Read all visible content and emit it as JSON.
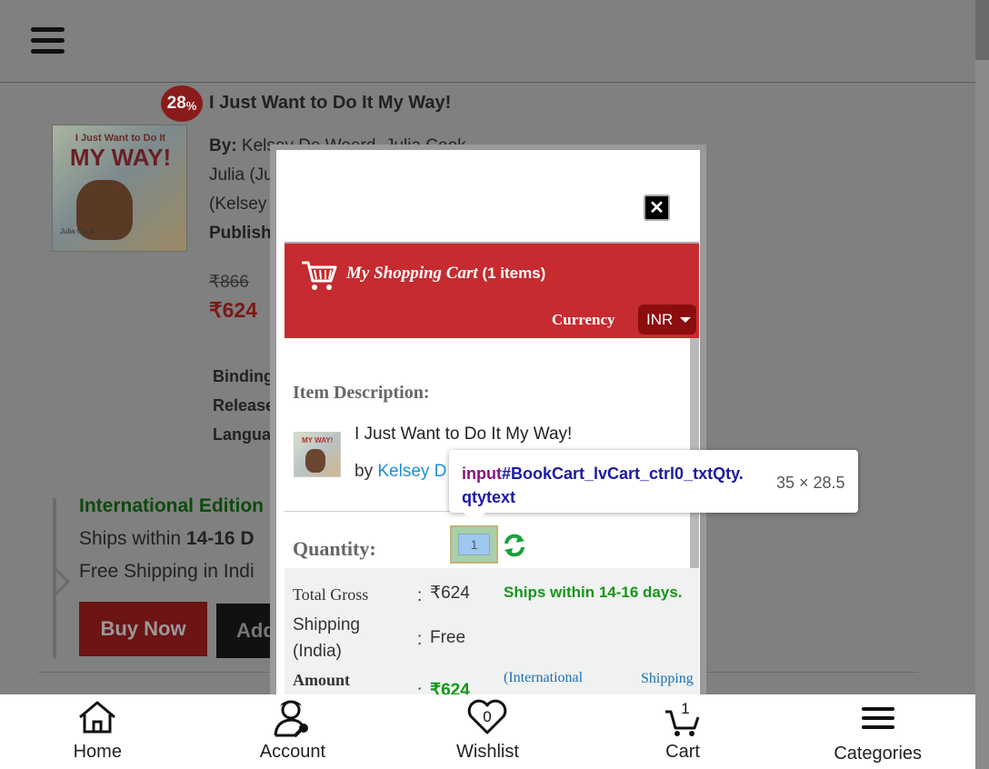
{
  "book": {
    "discount_value": "28",
    "discount_unit": "%",
    "title": "I Just Want to Do It My Way!",
    "cover_line1": "I Just Want to Do It",
    "cover_line2": "MY WAY!",
    "cover_author": "Julia Cook",
    "by_label": "By:",
    "authors_line1": "Kelsey De Weerd, Julia Cook",
    "authors_line2": "Julia (Ju",
    "authors_line3": "(Kelsey",
    "publisher": "Publish",
    "price_old": "₹866",
    "price_new": "₹624",
    "binding": "Binding",
    "release": "Release",
    "language": "Languag",
    "intl_title": "International Edition",
    "ships_text": "Ships within ",
    "ships_days": "14-16 D",
    "free_ship": "Free Shipping in Indi",
    "buy_now": "Buy Now",
    "add": "Add"
  },
  "modal": {
    "close_symbol": "✕",
    "cart_title": "My Shopping Cart",
    "cart_count": "(1 items)",
    "currency_label": "Currency",
    "currency_value": "INR",
    "item_desc_label": "Item Description:",
    "thumb_text": "MY WAY!",
    "item_name": "I Just Want to Do It My Way!",
    "item_by": "by ",
    "item_author_link": "Kelsey D",
    "qty_label": "Quantity:",
    "qty_value": "1",
    "total_gross_label": "Total Gross",
    "total_gross_value": "₹624",
    "ships_within": "Ships within 14-16 days.",
    "shipping_label_1": "Shipping",
    "shipping_label_2": "(India)",
    "shipping_value": "Free",
    "amount_label": "Amount",
    "amount_value": "₹624",
    "intl_link_1": "(International",
    "intl_link_2": "Shipping",
    "colon": ":"
  },
  "tooltip": {
    "tag": "input",
    "selector": "#BookCart_lvCart_ctrl0_txtQty.",
    "class": "qtytext",
    "size": "35 × 28.5"
  },
  "nav": [
    {
      "label": "Home",
      "icon": "home-icon"
    },
    {
      "label": "Account",
      "icon": "account-icon"
    },
    {
      "label": "Wishlist",
      "icon": "heart-icon",
      "badge": "0"
    },
    {
      "label": "Cart",
      "icon": "cart-icon",
      "badge": "1"
    },
    {
      "label": "Categories",
      "icon": "menu-icon"
    }
  ],
  "colors": {
    "cart_header": "#c52b2f",
    "link_blue": "#1a8fd6",
    "green": "#16961a"
  }
}
